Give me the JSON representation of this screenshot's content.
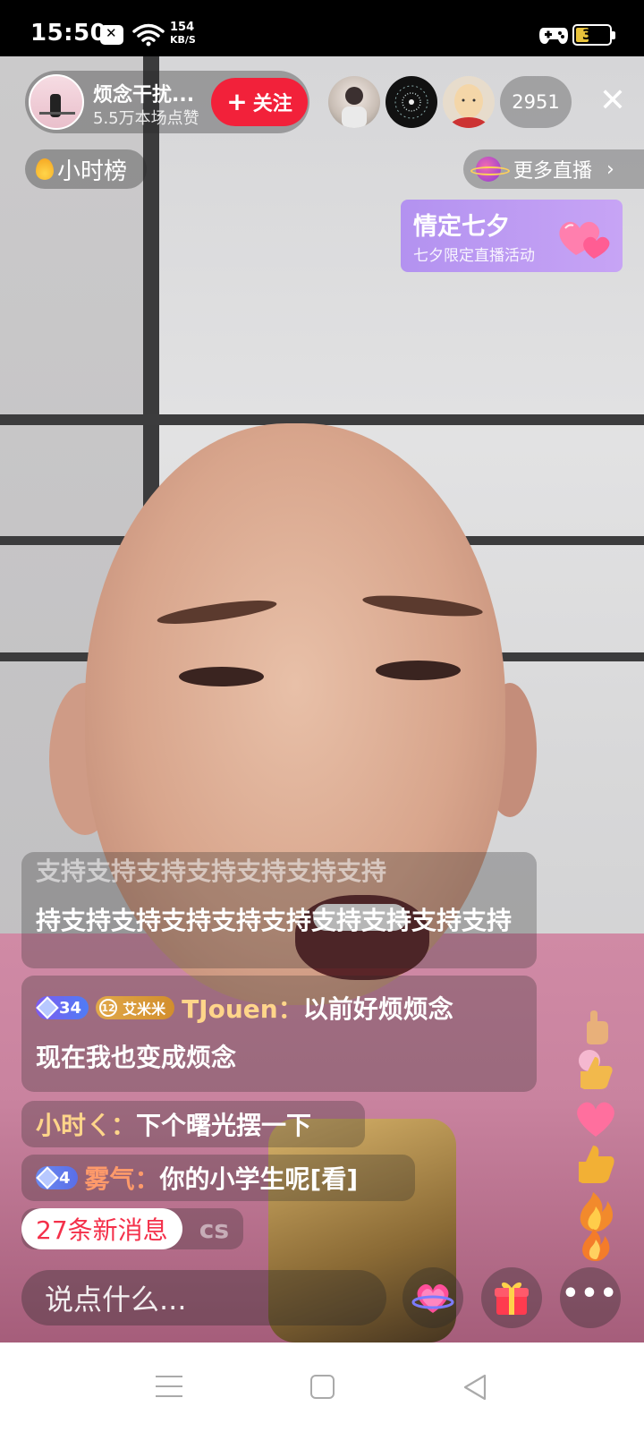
{
  "status_bar": {
    "time": "15:50",
    "net_speed_value": "154",
    "net_speed_unit": "KB/S",
    "battery": "39",
    "battery_level": 0.39,
    "icons": [
      "notification-icon",
      "wifi-icon",
      "game-mode-icon",
      "battery-icon"
    ]
  },
  "anchor": {
    "name": "烦念干扰...",
    "likes": "5.5万本场点赞",
    "follow_label": "关注",
    "follow_icon": "plus-icon"
  },
  "viewers": {
    "count": "2951",
    "avatars": [
      "viewer-avatar-1",
      "viewer-avatar-2",
      "viewer-avatar-3"
    ]
  },
  "close_icon": "close-icon",
  "hour_rank": {
    "label": "小时榜",
    "icon": "fire-icon"
  },
  "more_live": {
    "label": "更多直播",
    "icon": "planet-icon",
    "chevron": "›"
  },
  "event_banner": {
    "title": "情定七夕",
    "subtitle": "七夕限定直播活动",
    "icon": "heart-icon"
  },
  "chat": {
    "fading_top": "支持支持支持支持支持支持支持",
    "fading_body": "持支持支持支持支持支持支持支持支持支持",
    "messages": [
      {
        "level": "34",
        "fan_level": "12",
        "fan_club": "艾米米",
        "user": "TJouen：",
        "text_line1": "以前好烦烦念",
        "text_line2": "现在我也变成烦念"
      },
      {
        "user": "小时ㄑ：",
        "text": "下个曙光摆一下"
      },
      {
        "level": "4",
        "user": "雾气：",
        "text": "你的小学生呢[看]"
      }
    ],
    "partial_text": "cs",
    "new_messages": "27条新消息"
  },
  "bottom": {
    "input_placeholder": "说点什么...",
    "buttons": [
      "heart-planet-icon",
      "gift-icon",
      "more-icon"
    ],
    "more_label": "•••"
  },
  "colors": {
    "follow": "#f2213a",
    "username": "#ffd58a",
    "new_messages": "#f4304a",
    "event_banner": "#b392f0"
  }
}
